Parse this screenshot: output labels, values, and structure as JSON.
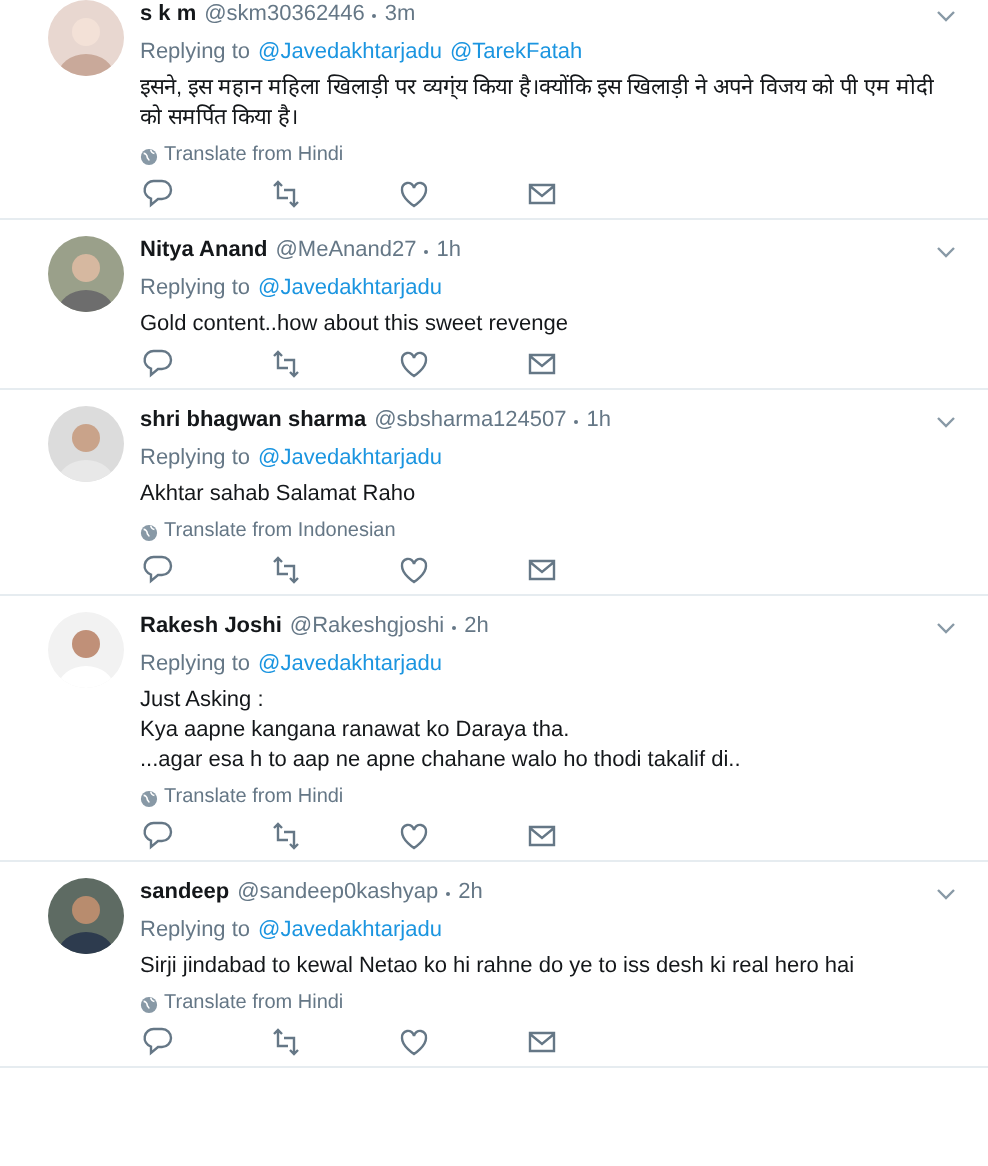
{
  "tweets": [
    {
      "name": "s k m",
      "handle": "@skm30362446",
      "time": "3m",
      "replying_label": "Replying to",
      "replying_to": [
        "@Javedakhtarjadu",
        "@TarekFatah"
      ],
      "text": "इसने, इस महान महिला खिलाड़ी पर व्यग्ंय किया है।क्योंकि इस खिलाड़ी ने अपने विजय को पी एम मोदी को समर्पित किया है।",
      "translate": "Translate from Hindi"
    },
    {
      "name": "Nitya Anand",
      "handle": "@MeAnand27",
      "time": "1h",
      "replying_label": "Replying to",
      "replying_to": [
        "@Javedakhtarjadu"
      ],
      "text": "Gold content..how about this sweet revenge"
    },
    {
      "name": "shri bhagwan sharma",
      "handle": "@sbsharma124507",
      "time": "1h",
      "replying_label": "Replying to",
      "replying_to": [
        "@Javedakhtarjadu"
      ],
      "text": "Akhtar sahab Salamat Raho",
      "translate": "Translate from Indonesian"
    },
    {
      "name": "Rakesh Joshi",
      "handle": "@Rakeshgjoshi",
      "time": "2h",
      "replying_label": "Replying to",
      "replying_to": [
        "@Javedakhtarjadu"
      ],
      "text": "Just Asking  :\nKya aapne kangana ranawat ko Daraya tha.\n...agar esa h to aap ne apne chahane walo ho thodi takalif di..",
      "translate": "Translate from Hindi"
    },
    {
      "name": "sandeep",
      "handle": "@sandeep0kashyap",
      "time": "2h",
      "replying_label": "Replying to",
      "replying_to": [
        "@Javedakhtarjadu"
      ],
      "text": "Sirji jindabad to kewal Netao ko hi rahne do ye to iss desh ki real hero hai",
      "translate": "Translate from Hindi"
    }
  ]
}
